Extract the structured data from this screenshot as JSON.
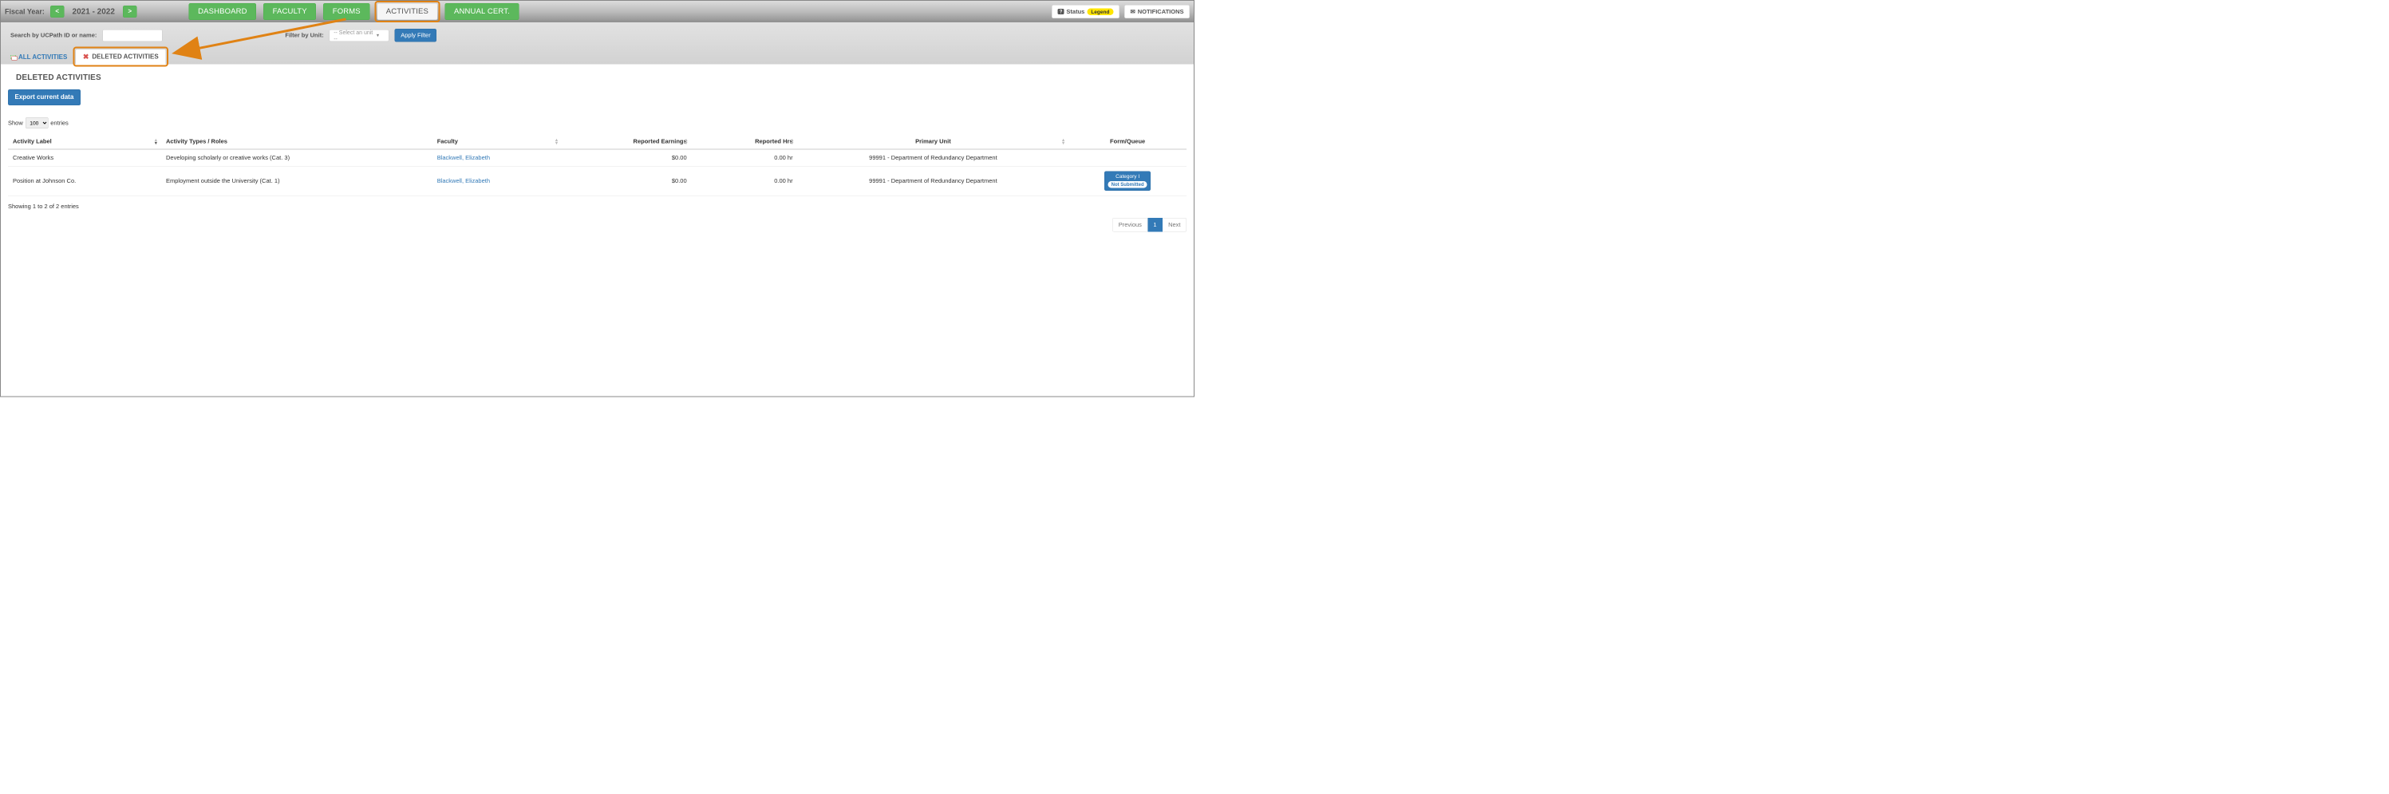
{
  "header": {
    "fiscal_label": "Fiscal Year:",
    "fiscal_prev": "<",
    "fiscal_value": "2021 - 2022",
    "fiscal_next": ">",
    "nav": {
      "dashboard": "DASHBOARD",
      "faculty": "FACULTY",
      "forms": "FORMS",
      "activities": "ACTIVITIES",
      "annual_cert": "ANNUAL CERT."
    },
    "status_label": "Status",
    "legend_label": "Legend",
    "notifications_label": "NOTIFICATIONS"
  },
  "filters": {
    "search_label": "Search by UCPath ID or name:",
    "search_value": "",
    "unit_label": "Filter by Unit:",
    "unit_placeholder": "-- Select an unit --",
    "apply_label": "Apply Filter"
  },
  "tabs": {
    "all": "ALL ACTIVITIES",
    "deleted": "DELETED ACTIVITIES"
  },
  "page": {
    "title": "DELETED ACTIVITIES",
    "export_label": "Export current data",
    "length_prefix": "Show",
    "length_value": "100",
    "length_suffix": "entries",
    "info": "Showing 1 to 2 of 2 entries"
  },
  "columns": {
    "activity_label": "Activity Label",
    "activity_types": "Activity Types / Roles",
    "faculty": "Faculty",
    "earnings": "Reported Earnings",
    "hrs": "Reported Hrs",
    "unit": "Primary Unit",
    "form": "Form/Queue"
  },
  "rows": [
    {
      "label": "Creative Works",
      "type": "Developing scholarly or creative works (Cat. 3)",
      "faculty": "Blackwell, Elizabeth",
      "earnings": "$0.00",
      "hrs": "0.00 hr",
      "unit": "99991 - Department of Redundancy Department",
      "form_cat": "",
      "form_status": ""
    },
    {
      "label": "Position at Johnson Co.",
      "type": "Employment outside the University (Cat. 1)",
      "faculty": "Blackwell, Elizabeth",
      "earnings": "$0.00",
      "hrs": "0.00 hr",
      "unit": "99991 - Department of Redundancy Department",
      "form_cat": "Category I",
      "form_status": "Not Submitted"
    }
  ],
  "pager": {
    "prev": "Previous",
    "page1": "1",
    "next": "Next"
  }
}
